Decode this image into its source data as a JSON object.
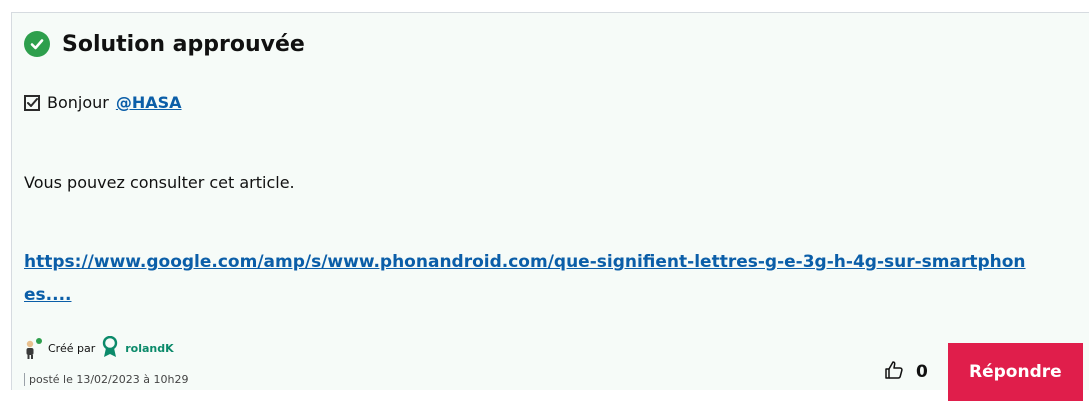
{
  "post": {
    "status_title": "Solution approuvée",
    "greeting_text": "Bonjour",
    "mention": "@HASA",
    "body_text": "Vous pouvez consulter cet article.",
    "link_text": "https://www.google.com/amp/s/www.phonandroid.com/que-signifient-lettres-g-e-3g-h-4g-sur-smartphones...."
  },
  "meta": {
    "created_by_label": "Créé par",
    "author": "rolandK",
    "posted_text": "posté le 13/02/2023 à 10h29"
  },
  "actions": {
    "like_count": "0",
    "reply_label": "Répondre"
  },
  "colors": {
    "success_green": "#2e9f4d",
    "link_blue": "#0b5ea8",
    "reply_red": "#e01e4b",
    "author_teal": "#0b8a6a"
  },
  "icons": {
    "status": "check-circle-icon",
    "greeting": "checkbox-checked-icon",
    "avatar": "user-avatar-icon",
    "author_badge": "award-ribbon-icon",
    "like": "thumbs-up-icon"
  }
}
